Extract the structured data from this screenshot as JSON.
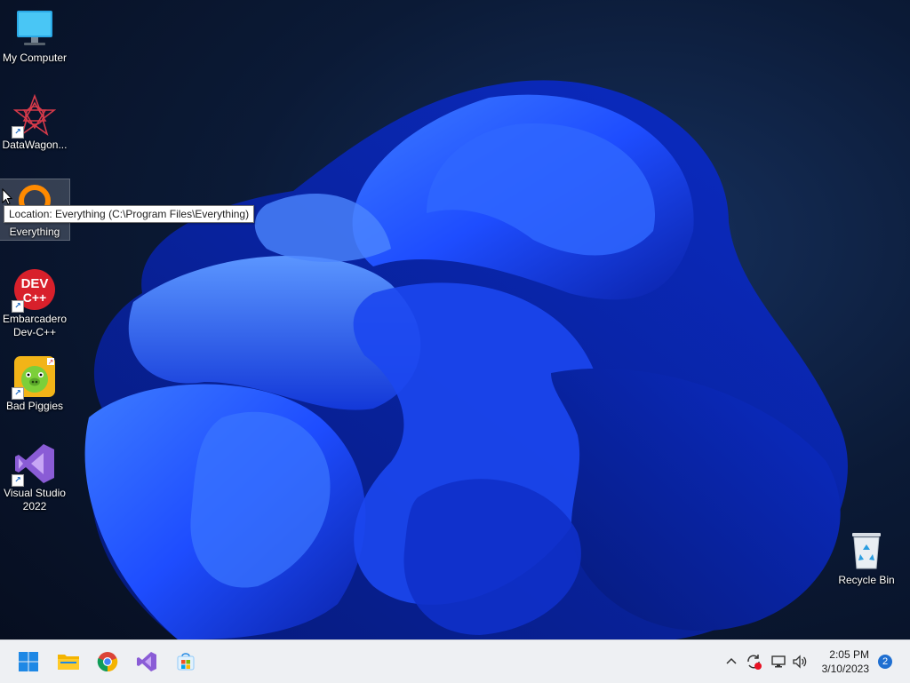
{
  "desktop": {
    "icons": [
      {
        "label": "My Computer",
        "icon": "monitor-icon"
      },
      {
        "label": "DataWagon...",
        "icon": "datawagon-icon"
      },
      {
        "label": "Everything",
        "icon": "everything-search-icon"
      },
      {
        "label": "Embarcadero Dev-C++",
        "label_line1": "Embarcadero",
        "label_line2": "Dev-C++",
        "icon": "devcpp-icon"
      },
      {
        "label": "Bad Piggies",
        "icon": "bad-piggies-icon"
      },
      {
        "label": "Visual Studio 2022",
        "label_line1": "Visual Studio",
        "label_line2": "2022",
        "icon": "visual-studio-icon"
      },
      {
        "label": "Recycle Bin",
        "icon": "recycle-bin-icon"
      }
    ],
    "tooltip": "Location: Everything (C:\\Program Files\\Everything)",
    "devcpp_logo_top": "DEV",
    "devcpp_logo_bottom": "C++"
  },
  "taskbar": {
    "pinned": [
      "start-button",
      "file-explorer",
      "chrome",
      "visual-studio",
      "microsoft-store"
    ],
    "tray": {
      "time": "2:05 PM",
      "date": "3/10/2023",
      "notifications": "2"
    }
  },
  "colors": {
    "accent": "#1f6fd1",
    "taskbar": "#eef0f3",
    "wallpaper_bloom": "#1a4cff"
  }
}
